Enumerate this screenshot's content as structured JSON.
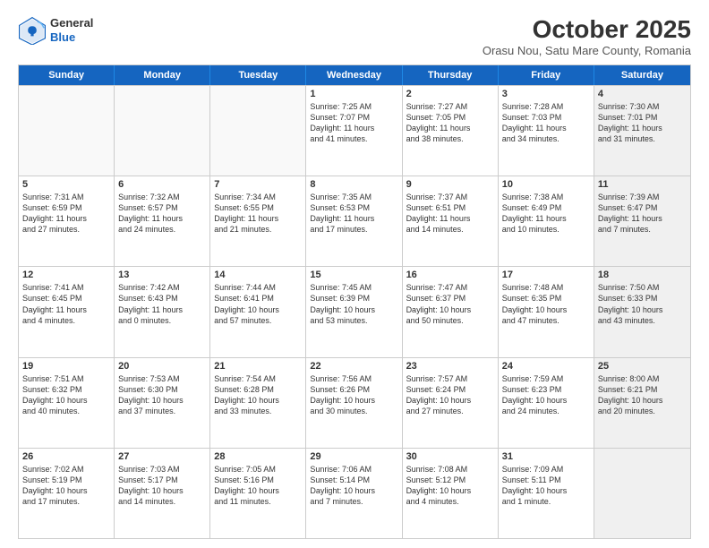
{
  "header": {
    "logo": {
      "general": "General",
      "blue": "Blue"
    },
    "month": "October 2025",
    "location": "Orasu Nou, Satu Mare County, Romania"
  },
  "days": [
    "Sunday",
    "Monday",
    "Tuesday",
    "Wednesday",
    "Thursday",
    "Friday",
    "Saturday"
  ],
  "rows": [
    [
      {
        "num": "",
        "text": "",
        "empty": true
      },
      {
        "num": "",
        "text": "",
        "empty": true
      },
      {
        "num": "",
        "text": "",
        "empty": true
      },
      {
        "num": "1",
        "text": "Sunrise: 7:25 AM\nSunset: 7:07 PM\nDaylight: 11 hours\nand 41 minutes."
      },
      {
        "num": "2",
        "text": "Sunrise: 7:27 AM\nSunset: 7:05 PM\nDaylight: 11 hours\nand 38 minutes."
      },
      {
        "num": "3",
        "text": "Sunrise: 7:28 AM\nSunset: 7:03 PM\nDaylight: 11 hours\nand 34 minutes."
      },
      {
        "num": "4",
        "text": "Sunrise: 7:30 AM\nSunset: 7:01 PM\nDaylight: 11 hours\nand 31 minutes.",
        "shaded": true
      }
    ],
    [
      {
        "num": "5",
        "text": "Sunrise: 7:31 AM\nSunset: 6:59 PM\nDaylight: 11 hours\nand 27 minutes."
      },
      {
        "num": "6",
        "text": "Sunrise: 7:32 AM\nSunset: 6:57 PM\nDaylight: 11 hours\nand 24 minutes."
      },
      {
        "num": "7",
        "text": "Sunrise: 7:34 AM\nSunset: 6:55 PM\nDaylight: 11 hours\nand 21 minutes."
      },
      {
        "num": "8",
        "text": "Sunrise: 7:35 AM\nSunset: 6:53 PM\nDaylight: 11 hours\nand 17 minutes."
      },
      {
        "num": "9",
        "text": "Sunrise: 7:37 AM\nSunset: 6:51 PM\nDaylight: 11 hours\nand 14 minutes."
      },
      {
        "num": "10",
        "text": "Sunrise: 7:38 AM\nSunset: 6:49 PM\nDaylight: 11 hours\nand 10 minutes."
      },
      {
        "num": "11",
        "text": "Sunrise: 7:39 AM\nSunset: 6:47 PM\nDaylight: 11 hours\nand 7 minutes.",
        "shaded": true
      }
    ],
    [
      {
        "num": "12",
        "text": "Sunrise: 7:41 AM\nSunset: 6:45 PM\nDaylight: 11 hours\nand 4 minutes."
      },
      {
        "num": "13",
        "text": "Sunrise: 7:42 AM\nSunset: 6:43 PM\nDaylight: 11 hours\nand 0 minutes."
      },
      {
        "num": "14",
        "text": "Sunrise: 7:44 AM\nSunset: 6:41 PM\nDaylight: 10 hours\nand 57 minutes."
      },
      {
        "num": "15",
        "text": "Sunrise: 7:45 AM\nSunset: 6:39 PM\nDaylight: 10 hours\nand 53 minutes."
      },
      {
        "num": "16",
        "text": "Sunrise: 7:47 AM\nSunset: 6:37 PM\nDaylight: 10 hours\nand 50 minutes."
      },
      {
        "num": "17",
        "text": "Sunrise: 7:48 AM\nSunset: 6:35 PM\nDaylight: 10 hours\nand 47 minutes."
      },
      {
        "num": "18",
        "text": "Sunrise: 7:50 AM\nSunset: 6:33 PM\nDaylight: 10 hours\nand 43 minutes.",
        "shaded": true
      }
    ],
    [
      {
        "num": "19",
        "text": "Sunrise: 7:51 AM\nSunset: 6:32 PM\nDaylight: 10 hours\nand 40 minutes."
      },
      {
        "num": "20",
        "text": "Sunrise: 7:53 AM\nSunset: 6:30 PM\nDaylight: 10 hours\nand 37 minutes."
      },
      {
        "num": "21",
        "text": "Sunrise: 7:54 AM\nSunset: 6:28 PM\nDaylight: 10 hours\nand 33 minutes."
      },
      {
        "num": "22",
        "text": "Sunrise: 7:56 AM\nSunset: 6:26 PM\nDaylight: 10 hours\nand 30 minutes."
      },
      {
        "num": "23",
        "text": "Sunrise: 7:57 AM\nSunset: 6:24 PM\nDaylight: 10 hours\nand 27 minutes."
      },
      {
        "num": "24",
        "text": "Sunrise: 7:59 AM\nSunset: 6:23 PM\nDaylight: 10 hours\nand 24 minutes."
      },
      {
        "num": "25",
        "text": "Sunrise: 8:00 AM\nSunset: 6:21 PM\nDaylight: 10 hours\nand 20 minutes.",
        "shaded": true
      }
    ],
    [
      {
        "num": "26",
        "text": "Sunrise: 7:02 AM\nSunset: 5:19 PM\nDaylight: 10 hours\nand 17 minutes."
      },
      {
        "num": "27",
        "text": "Sunrise: 7:03 AM\nSunset: 5:17 PM\nDaylight: 10 hours\nand 14 minutes."
      },
      {
        "num": "28",
        "text": "Sunrise: 7:05 AM\nSunset: 5:16 PM\nDaylight: 10 hours\nand 11 minutes."
      },
      {
        "num": "29",
        "text": "Sunrise: 7:06 AM\nSunset: 5:14 PM\nDaylight: 10 hours\nand 7 minutes."
      },
      {
        "num": "30",
        "text": "Sunrise: 7:08 AM\nSunset: 5:12 PM\nDaylight: 10 hours\nand 4 minutes."
      },
      {
        "num": "31",
        "text": "Sunrise: 7:09 AM\nSunset: 5:11 PM\nDaylight: 10 hours\nand 1 minute."
      },
      {
        "num": "",
        "text": "",
        "empty": true,
        "shaded": true
      }
    ]
  ]
}
